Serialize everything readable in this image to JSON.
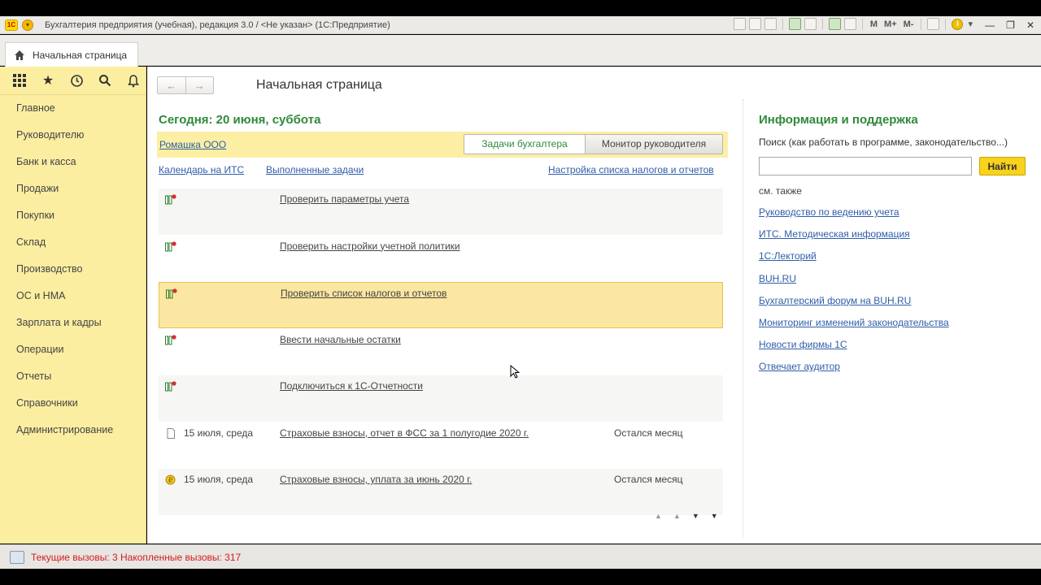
{
  "window": {
    "title": "Бухгалтерия предприятия (учебная), редакция 3.0 / <Не указан>  (1С:Предприятие)",
    "logo_text": "1С",
    "toolbar_labels": [
      "M",
      "M+",
      "M-"
    ]
  },
  "tabs": {
    "home_label": "Начальная страница"
  },
  "sidebar": {
    "items": [
      {
        "label": "Главное"
      },
      {
        "label": "Руководителю"
      },
      {
        "label": "Банк и касса"
      },
      {
        "label": "Продажи"
      },
      {
        "label": "Покупки"
      },
      {
        "label": "Склад"
      },
      {
        "label": "Производство"
      },
      {
        "label": "ОС и НМА"
      },
      {
        "label": "Зарплата и кадры"
      },
      {
        "label": "Операции"
      },
      {
        "label": "Отчеты"
      },
      {
        "label": "Справочники"
      },
      {
        "label": "Администрирование"
      }
    ]
  },
  "main": {
    "page_title": "Начальная страница",
    "today": "Сегодня: 20 июня, суббота",
    "company": "Ромашка ООО",
    "segment": {
      "active": "Задачи бухгалтера",
      "inactive": "Монитор руководителя"
    },
    "links": {
      "calendar": "Календарь на ИТС",
      "done_tasks": "Выполненные задачи",
      "tax_settings": "Настройка списка налогов и отчетов"
    },
    "tasks": [
      {
        "icon": "checklist-icon",
        "date": "",
        "label": "Проверить параметры учета",
        "remain": ""
      },
      {
        "icon": "checklist-icon",
        "date": "",
        "label": "Проверить настройки учетной политики",
        "remain": ""
      },
      {
        "icon": "checklist-icon",
        "date": "",
        "label": "Проверить список налогов и отчетов",
        "remain": ""
      },
      {
        "icon": "checklist-icon",
        "date": "",
        "label": "Ввести начальные остатки",
        "remain": ""
      },
      {
        "icon": "checklist-icon",
        "date": "",
        "label": "Подключиться к 1С-Отчетности",
        "remain": ""
      },
      {
        "icon": "document-icon",
        "date": "15 июля, среда",
        "label": "Страховые взносы, отчет в ФСС за 1 полугодие 2020 г.",
        "remain": "Остался месяц"
      },
      {
        "icon": "coin-icon",
        "date": "15 июля, среда",
        "label": "Страховые взносы, уплата за июнь 2020 г.",
        "remain": "Остался месяц"
      }
    ]
  },
  "info": {
    "title": "Информация и поддержка",
    "search_label": "Поиск (как работать в программе, законодательство...)",
    "search_value": "",
    "find_button": "Найти",
    "see_also": "см. также",
    "links": [
      "Руководство по ведению учета",
      "ИТС. Методическая информация",
      "1С:Лекторий",
      "BUH.RU",
      "Бухгалтерский форум на BUH.RU",
      "Мониторинг изменений законодательства",
      "Новости фирмы 1С",
      "Отвечает аудитор"
    ]
  },
  "status": {
    "text": "Текущие вызовы: 3    Накопленные вызовы: 317"
  },
  "colors": {
    "sidebar_bg": "#fbeea1",
    "accent_green": "#2e8a3a",
    "link_blue": "#2f5ea8",
    "status_red": "#d61a1a",
    "find_button": "#f9d21b"
  }
}
